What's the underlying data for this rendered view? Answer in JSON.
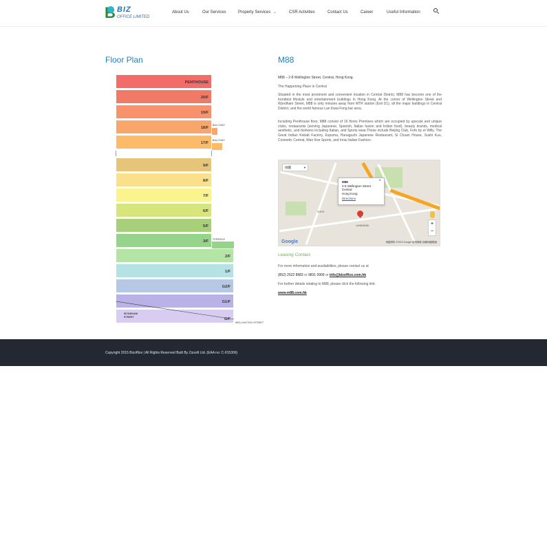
{
  "header": {
    "logo": {
      "mark": "B",
      "name": "BIZ",
      "subtitle": "OFFICE LIMITED"
    },
    "nav": [
      {
        "label": "About Us"
      },
      {
        "label": "Our Services"
      },
      {
        "label": "Property Services",
        "has_dropdown": true
      },
      {
        "label": "CSR Activities"
      },
      {
        "label": "Contact Us"
      },
      {
        "label": "Career"
      },
      {
        "label": "Useful Information"
      }
    ],
    "search_icon": "search-icon"
  },
  "floor_plan": {
    "title": "Floor Plan",
    "floors": [
      {
        "label": "PENTHOUSE",
        "color": "#f26d6a"
      },
      {
        "label": "20/F",
        "color": "#f07a66"
      },
      {
        "label": "19/F",
        "color": "#f8926d"
      },
      {
        "label": "18/F",
        "color": "#f9a66c"
      },
      {
        "label": "17/F",
        "color": "#fbbb68"
      },
      {
        "label": "9/F",
        "color": "#e6c57a"
      },
      {
        "label": "8/F",
        "color": "#fbe08c"
      },
      {
        "label": "7/F",
        "color": "#f9f48e"
      },
      {
        "label": "6/F",
        "color": "#d6e57c"
      },
      {
        "label": "5/F",
        "color": "#a8d07a"
      },
      {
        "label": "3/F",
        "color": "#95d48a"
      },
      {
        "label": "2/F",
        "color": "#b4e4a6"
      },
      {
        "label": "1/F",
        "color": "#b5e2e4"
      },
      {
        "label": "G2/F",
        "color": "#b5c8e6"
      },
      {
        "label": "G1/F",
        "color": "#b9b2e6"
      },
      {
        "label": "G/F",
        "color": "#d8ccf0"
      }
    ],
    "annex_labels": {
      "balcony": "BALCONY",
      "terrace": "TERRACE"
    },
    "street_left": "WYNDHAM\nSTREET",
    "street_right": "WELLINGTON STREET"
  },
  "building": {
    "title": "M88",
    "address": "M88 – 2-8 Wellington Street, Central, Hong Kong.",
    "tagline": "The Happening Place in Central",
    "paragraph1": "Situated in the most prominent and convenient location in Central District, M88 has become one of the trendiest lifestyle and entertainment buildings in Hong Kong. At the corner of Wellington Street and Wyndham Street, M88 is only minutes away from MTR station (Exit D1), all the major buildings in Central District, and the world famous Lan Kwai Fong bar area.",
    "paragraph2": "Including Penthouse floor, M88 consist of 16 floors Premises which are occupied by upscale and unique clubs, restaurants (serving Japanese, Spanish, Italian fusion and Indian food), beauty brands, medical aesthetic, and fashions including Italian, and Sports wear.These include Beijing Club, Fofo by el Willy, The Great Indian Kebab Factory, Espuma, Hanagushi Japanese Restaurant, Si Chuan House, Sushi Kuu, Cosmetic Central, Wan Kee Sports, and Inniu Italian Fashion."
  },
  "map": {
    "map_type": "地圖",
    "popup": {
      "title": "M88",
      "line1": "2-8 Wellington Street",
      "line2": "Central",
      "line3": "Hong Kong",
      "directions": "Directions"
    },
    "zoom_in": "+",
    "zoom_out": "−",
    "google": "Google",
    "attribution": "地圖資料 ©2015 Google   使用條款   回報地圖錯誤",
    "labels": {
      "landmark": "LANDMARK",
      "soho": "SOHO"
    }
  },
  "leasing": {
    "title": "Leasing Contact",
    "intro": "For more information and availabilities, please contact us at",
    "phone1": "(852) 2522 8983",
    "or1": " or ",
    "phone2": "9831 0909",
    "or2": " or ",
    "email": "info@bizoffice.com.hk",
    "further": "For further details relating to M88, please click the following link:",
    "website": "www.m88.com.hk"
  },
  "footer": {
    "copyright": "Copyright 2015 Bizoffice | All Rights Reserved Built By Zizsoft Ltd. (EAA no: C-015306)"
  }
}
